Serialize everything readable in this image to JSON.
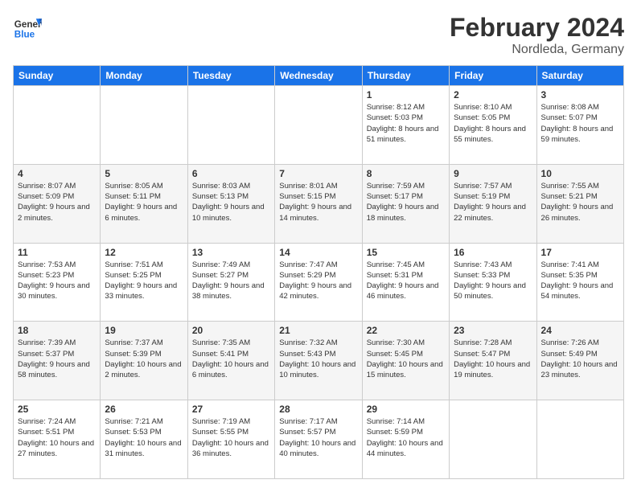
{
  "header": {
    "logo_general": "General",
    "logo_blue": "Blue",
    "month_title": "February 2024",
    "location": "Nordleda, Germany"
  },
  "days_of_week": [
    "Sunday",
    "Monday",
    "Tuesday",
    "Wednesday",
    "Thursday",
    "Friday",
    "Saturday"
  ],
  "weeks": [
    [
      {
        "day": "",
        "sunrise": "",
        "sunset": "",
        "daylight": ""
      },
      {
        "day": "",
        "sunrise": "",
        "sunset": "",
        "daylight": ""
      },
      {
        "day": "",
        "sunrise": "",
        "sunset": "",
        "daylight": ""
      },
      {
        "day": "",
        "sunrise": "",
        "sunset": "",
        "daylight": ""
      },
      {
        "day": "1",
        "sunrise": "Sunrise: 8:12 AM",
        "sunset": "Sunset: 5:03 PM",
        "daylight": "Daylight: 8 hours and 51 minutes."
      },
      {
        "day": "2",
        "sunrise": "Sunrise: 8:10 AM",
        "sunset": "Sunset: 5:05 PM",
        "daylight": "Daylight: 8 hours and 55 minutes."
      },
      {
        "day": "3",
        "sunrise": "Sunrise: 8:08 AM",
        "sunset": "Sunset: 5:07 PM",
        "daylight": "Daylight: 8 hours and 59 minutes."
      }
    ],
    [
      {
        "day": "4",
        "sunrise": "Sunrise: 8:07 AM",
        "sunset": "Sunset: 5:09 PM",
        "daylight": "Daylight: 9 hours and 2 minutes."
      },
      {
        "day": "5",
        "sunrise": "Sunrise: 8:05 AM",
        "sunset": "Sunset: 5:11 PM",
        "daylight": "Daylight: 9 hours and 6 minutes."
      },
      {
        "day": "6",
        "sunrise": "Sunrise: 8:03 AM",
        "sunset": "Sunset: 5:13 PM",
        "daylight": "Daylight: 9 hours and 10 minutes."
      },
      {
        "day": "7",
        "sunrise": "Sunrise: 8:01 AM",
        "sunset": "Sunset: 5:15 PM",
        "daylight": "Daylight: 9 hours and 14 minutes."
      },
      {
        "day": "8",
        "sunrise": "Sunrise: 7:59 AM",
        "sunset": "Sunset: 5:17 PM",
        "daylight": "Daylight: 9 hours and 18 minutes."
      },
      {
        "day": "9",
        "sunrise": "Sunrise: 7:57 AM",
        "sunset": "Sunset: 5:19 PM",
        "daylight": "Daylight: 9 hours and 22 minutes."
      },
      {
        "day": "10",
        "sunrise": "Sunrise: 7:55 AM",
        "sunset": "Sunset: 5:21 PM",
        "daylight": "Daylight: 9 hours and 26 minutes."
      }
    ],
    [
      {
        "day": "11",
        "sunrise": "Sunrise: 7:53 AM",
        "sunset": "Sunset: 5:23 PM",
        "daylight": "Daylight: 9 hours and 30 minutes."
      },
      {
        "day": "12",
        "sunrise": "Sunrise: 7:51 AM",
        "sunset": "Sunset: 5:25 PM",
        "daylight": "Daylight: 9 hours and 33 minutes."
      },
      {
        "day": "13",
        "sunrise": "Sunrise: 7:49 AM",
        "sunset": "Sunset: 5:27 PM",
        "daylight": "Daylight: 9 hours and 38 minutes."
      },
      {
        "day": "14",
        "sunrise": "Sunrise: 7:47 AM",
        "sunset": "Sunset: 5:29 PM",
        "daylight": "Daylight: 9 hours and 42 minutes."
      },
      {
        "day": "15",
        "sunrise": "Sunrise: 7:45 AM",
        "sunset": "Sunset: 5:31 PM",
        "daylight": "Daylight: 9 hours and 46 minutes."
      },
      {
        "day": "16",
        "sunrise": "Sunrise: 7:43 AM",
        "sunset": "Sunset: 5:33 PM",
        "daylight": "Daylight: 9 hours and 50 minutes."
      },
      {
        "day": "17",
        "sunrise": "Sunrise: 7:41 AM",
        "sunset": "Sunset: 5:35 PM",
        "daylight": "Daylight: 9 hours and 54 minutes."
      }
    ],
    [
      {
        "day": "18",
        "sunrise": "Sunrise: 7:39 AM",
        "sunset": "Sunset: 5:37 PM",
        "daylight": "Daylight: 9 hours and 58 minutes."
      },
      {
        "day": "19",
        "sunrise": "Sunrise: 7:37 AM",
        "sunset": "Sunset: 5:39 PM",
        "daylight": "Daylight: 10 hours and 2 minutes."
      },
      {
        "day": "20",
        "sunrise": "Sunrise: 7:35 AM",
        "sunset": "Sunset: 5:41 PM",
        "daylight": "Daylight: 10 hours and 6 minutes."
      },
      {
        "day": "21",
        "sunrise": "Sunrise: 7:32 AM",
        "sunset": "Sunset: 5:43 PM",
        "daylight": "Daylight: 10 hours and 10 minutes."
      },
      {
        "day": "22",
        "sunrise": "Sunrise: 7:30 AM",
        "sunset": "Sunset: 5:45 PM",
        "daylight": "Daylight: 10 hours and 15 minutes."
      },
      {
        "day": "23",
        "sunrise": "Sunrise: 7:28 AM",
        "sunset": "Sunset: 5:47 PM",
        "daylight": "Daylight: 10 hours and 19 minutes."
      },
      {
        "day": "24",
        "sunrise": "Sunrise: 7:26 AM",
        "sunset": "Sunset: 5:49 PM",
        "daylight": "Daylight: 10 hours and 23 minutes."
      }
    ],
    [
      {
        "day": "25",
        "sunrise": "Sunrise: 7:24 AM",
        "sunset": "Sunset: 5:51 PM",
        "daylight": "Daylight: 10 hours and 27 minutes."
      },
      {
        "day": "26",
        "sunrise": "Sunrise: 7:21 AM",
        "sunset": "Sunset: 5:53 PM",
        "daylight": "Daylight: 10 hours and 31 minutes."
      },
      {
        "day": "27",
        "sunrise": "Sunrise: 7:19 AM",
        "sunset": "Sunset: 5:55 PM",
        "daylight": "Daylight: 10 hours and 36 minutes."
      },
      {
        "day": "28",
        "sunrise": "Sunrise: 7:17 AM",
        "sunset": "Sunset: 5:57 PM",
        "daylight": "Daylight: 10 hours and 40 minutes."
      },
      {
        "day": "29",
        "sunrise": "Sunrise: 7:14 AM",
        "sunset": "Sunset: 5:59 PM",
        "daylight": "Daylight: 10 hours and 44 minutes."
      },
      {
        "day": "",
        "sunrise": "",
        "sunset": "",
        "daylight": ""
      },
      {
        "day": "",
        "sunrise": "",
        "sunset": "",
        "daylight": ""
      }
    ]
  ]
}
